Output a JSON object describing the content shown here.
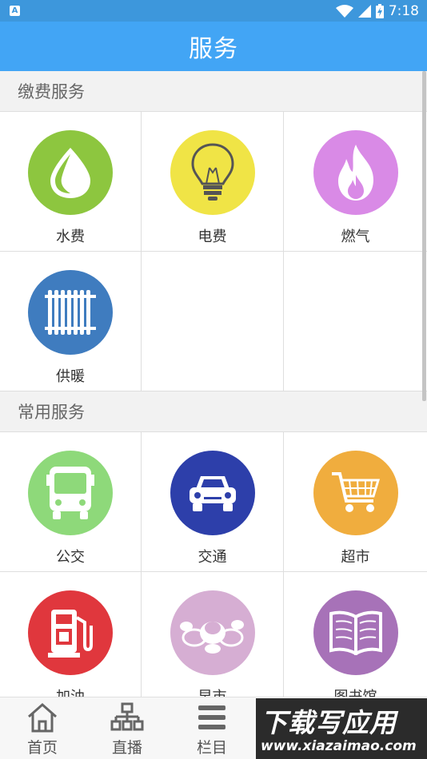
{
  "status_bar": {
    "time": "7:18",
    "app_icon": "A"
  },
  "app_bar": {
    "title": "服务"
  },
  "sections": [
    {
      "title": "缴费服务",
      "items": [
        {
          "label": "水费",
          "icon": "water-drop-icon",
          "color": "#8dc63f"
        },
        {
          "label": "电费",
          "icon": "light-bulb-icon",
          "color": "#f0e446"
        },
        {
          "label": "燃气",
          "icon": "flame-icon",
          "color": "#d98ae6"
        },
        {
          "label": "供暖",
          "icon": "radiator-icon",
          "color": "#3f7cbf"
        }
      ]
    },
    {
      "title": "常用服务",
      "items": [
        {
          "label": "公交",
          "icon": "bus-icon",
          "color": "#8ed97a"
        },
        {
          "label": "交通",
          "icon": "car-icon",
          "color": "#2d3faa"
        },
        {
          "label": "超市",
          "icon": "shopping-cart-icon",
          "color": "#f0ad3e"
        },
        {
          "label": "加油",
          "icon": "fuel-pump-icon",
          "color": "#e0373d"
        },
        {
          "label": "早市",
          "icon": "produce-icon",
          "color": "#d6aed3"
        },
        {
          "label": "图书馆",
          "icon": "book-icon",
          "color": "#a772b8"
        }
      ]
    }
  ],
  "bottom_nav": [
    {
      "label": "首页",
      "icon": "home-icon"
    },
    {
      "label": "直播",
      "icon": "sitemap-icon"
    },
    {
      "label": "栏目",
      "icon": "menu-icon"
    }
  ],
  "watermark": {
    "title": "下载写应用",
    "url": "www.xiazaimao.com"
  }
}
